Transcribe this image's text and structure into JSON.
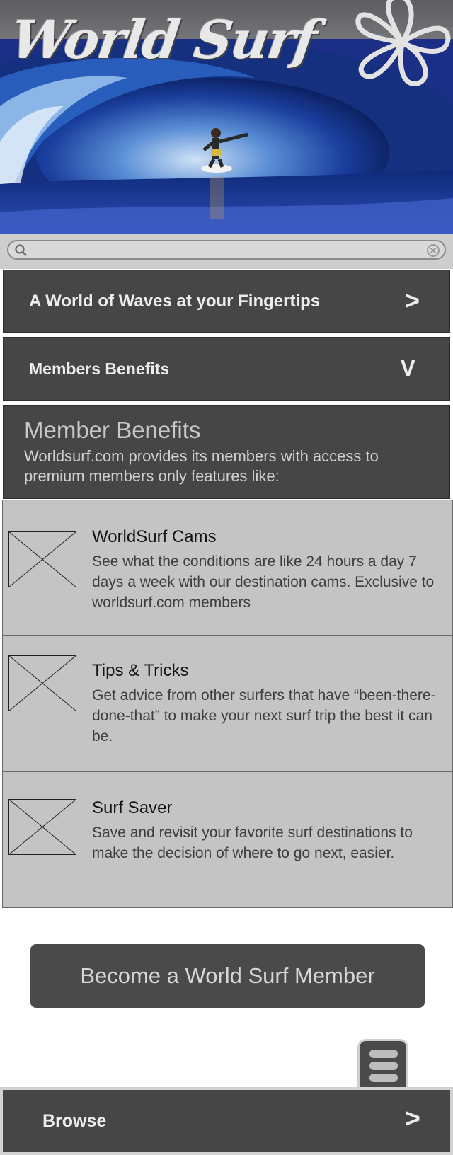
{
  "header": {
    "logo_text": "World Surf",
    "logo_icon": "hibiscus-icon"
  },
  "search": {
    "placeholder": "",
    "search_icon": "search-icon",
    "clear_icon": "clear-icon"
  },
  "nav": {
    "item1_label": "A World of Waves at your Fingertips",
    "item1_chevron": ">",
    "item2_label": "Members Benefits",
    "item2_chevron": "V"
  },
  "benefits": {
    "title": "Member Benefits",
    "description": "Worldsurf.com provides its members with access to premium members only features like:",
    "features": [
      {
        "title": "WorldSurf Cams",
        "description": "See what the conditions are like 24 hours a day 7 days a week with our destination cams. Exclusive to worldsurf.com members"
      },
      {
        "title": "Tips & Tricks",
        "description": "Get advice from other surfers that have “been-there-done-that” to make your next surf trip the best it can be."
      },
      {
        "title": "Surf Saver",
        "description": "Save and revisit your favorite surf destinations to make the decision of where to go next, easier."
      }
    ]
  },
  "cta": {
    "label": "Become a World Surf Member"
  },
  "menu": {
    "icon": "hamburger-menu-icon"
  },
  "footer": {
    "browse_label": "Browse",
    "browse_chevron": ">"
  },
  "colors": {
    "bar_dark": "#464646",
    "feature_bg": "#c4c4c4",
    "ocean_blue": "#1d2f8c"
  }
}
